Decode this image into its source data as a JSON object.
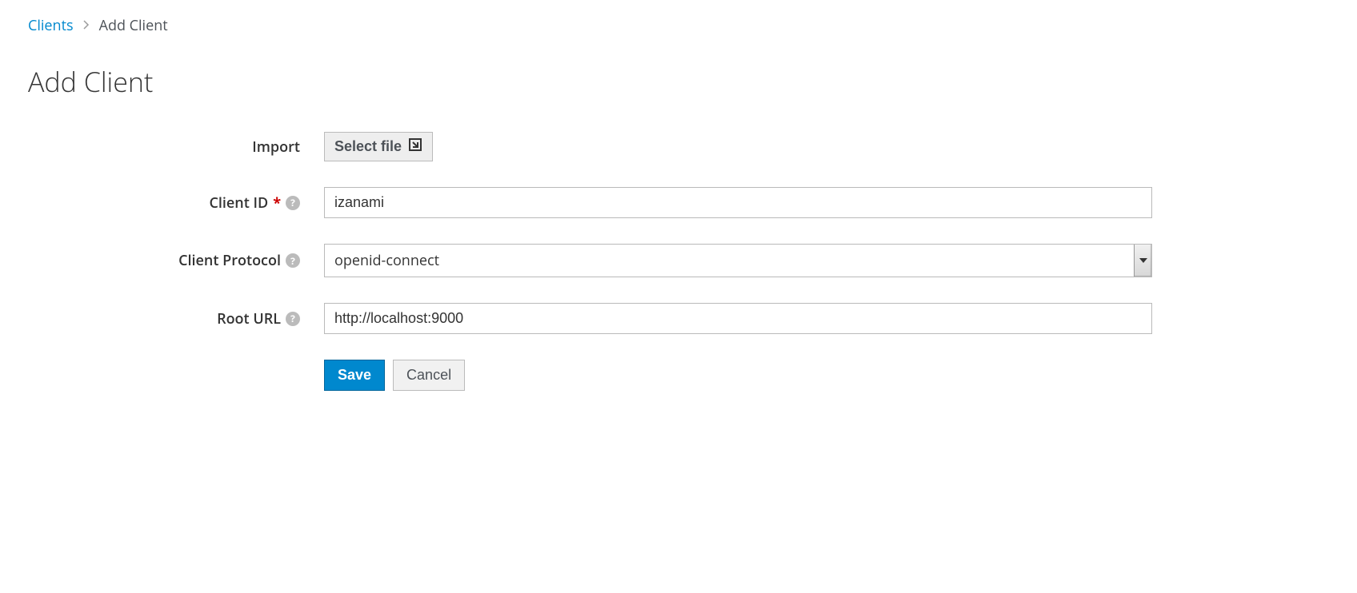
{
  "breadcrumb": {
    "parent": "Clients",
    "current": "Add Client"
  },
  "page": {
    "title": "Add Client"
  },
  "form": {
    "import": {
      "label": "Import",
      "button": "Select file"
    },
    "client_id": {
      "label": "Client ID",
      "value": "izanami",
      "required": true
    },
    "client_protocol": {
      "label": "Client Protocol",
      "value": "openid-connect"
    },
    "root_url": {
      "label": "Root URL",
      "value": "http://localhost:9000"
    },
    "actions": {
      "save": "Save",
      "cancel": "Cancel"
    }
  }
}
